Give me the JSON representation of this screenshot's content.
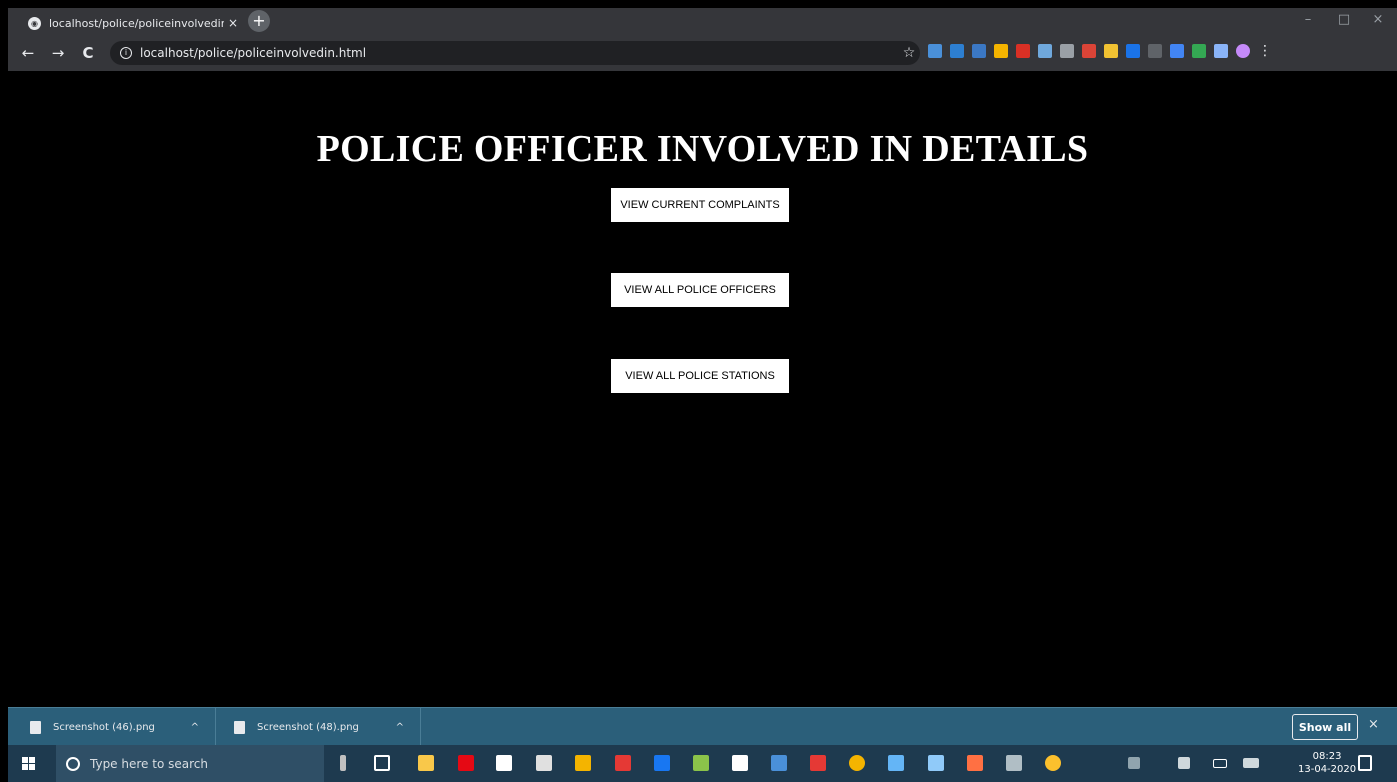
{
  "browser": {
    "tab_title": "localhost/police/policeinvolvedin",
    "tab_close_glyph": "×",
    "new_tab_glyph": "+",
    "url": "localhost/police/policeinvolvedin.html",
    "back_glyph": "←",
    "forward_glyph": "→",
    "reload_glyph": "C",
    "star_glyph": "☆",
    "menu_glyph": "⋮",
    "minimize_glyph": "–",
    "maximize_glyph": "□",
    "close_glyph": "×"
  },
  "page": {
    "title": "POLICE OFFICER INVOLVED IN DETAILS",
    "buttons": [
      {
        "label": "VIEW CURRENT COMPLAINTS"
      },
      {
        "label": "VIEW ALL POLICE OFFICERS"
      },
      {
        "label": "VIEW ALL POLICE STATIONS"
      }
    ]
  },
  "downloads": {
    "items": [
      {
        "filename": "Screenshot (46).png",
        "caret": "^"
      },
      {
        "filename": "Screenshot (48).png",
        "caret": "^"
      }
    ],
    "show_all_label": "Show all",
    "close_glyph": "×"
  },
  "taskbar": {
    "search_placeholder": "Type here to search",
    "time": "08:23",
    "date": "13-04-2020"
  },
  "colors": {
    "page_bg": "#000000",
    "title_text": "#ffffff",
    "button_bg": "#ffffff",
    "download_shelf": "#2b5f7a",
    "taskbar": "#1e3a4f"
  }
}
